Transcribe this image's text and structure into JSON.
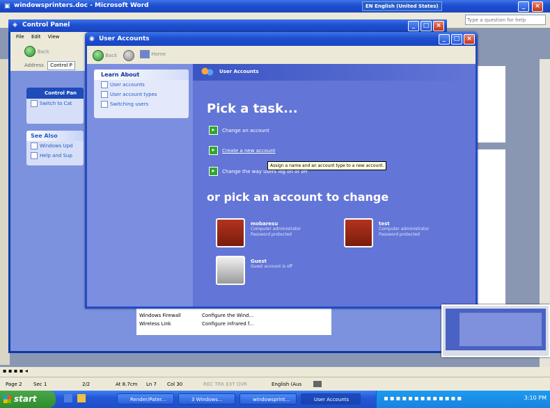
{
  "word": {
    "title": "windowsprinters.doc - Microsoft Word",
    "language": "EN English (United States)",
    "ask_placeholder": "Type a question for help",
    "status": {
      "page": "Page 2",
      "sec": "Sec 1",
      "pages": "2/2",
      "at": "At 8.7cm",
      "ln": "Ln 7",
      "col": "Col 30",
      "modes": "REC TRK EXT OVR",
      "lang": "English (Aus"
    }
  },
  "control_panel": {
    "title": "Control Panel",
    "menu": [
      "File",
      "Edit",
      "View"
    ],
    "back_label": "Back",
    "address_label": "Address",
    "address_value": "Control P",
    "side_title": "Control Pan",
    "switch_label": "Switch to Cat",
    "see_also_title": "See Also",
    "see_also": [
      "Windows Upd",
      "Help and Sup"
    ],
    "list_rows": [
      {
        "name": "Windows Firewall",
        "desc": "Configure the Wind..."
      },
      {
        "name": "Wireless Link",
        "desc": "Configure infrared f..."
      }
    ]
  },
  "user_accounts": {
    "title": "User Accounts",
    "toolbar": {
      "back": "Back",
      "home": "Home"
    },
    "header_title": "User Accounts",
    "learn_about": {
      "title": "Learn About",
      "items": [
        "User accounts",
        "User account types",
        "Switching users"
      ]
    },
    "pick_task": "Pick a task...",
    "tasks": [
      "Change an account",
      "Create a new account",
      "Change the way users log on or off"
    ],
    "tooltip": "Assign a name and an account type to a new account.",
    "pick_account": "or pick an account to change",
    "accounts": [
      {
        "name": "mobaresu",
        "line1": "Computer administrator",
        "line2": "Password protected"
      },
      {
        "name": "test",
        "line1": "Computer administrator",
        "line2": "Password protected"
      },
      {
        "name": "Guest",
        "line1": "Guest account is off",
        "line2": ""
      }
    ]
  },
  "taskbar": {
    "start": "start",
    "items": [
      "Render/Pater...",
      "3 Windows...",
      "windowsprint...",
      "User Accounts"
    ],
    "clock": "3:10 PM"
  },
  "colors": {
    "ua_blue": "#6375d6",
    "ua_sidebar": "#7c8ee0",
    "taskbar_blue": "#245edb",
    "start_green": "#3c9a3c"
  }
}
